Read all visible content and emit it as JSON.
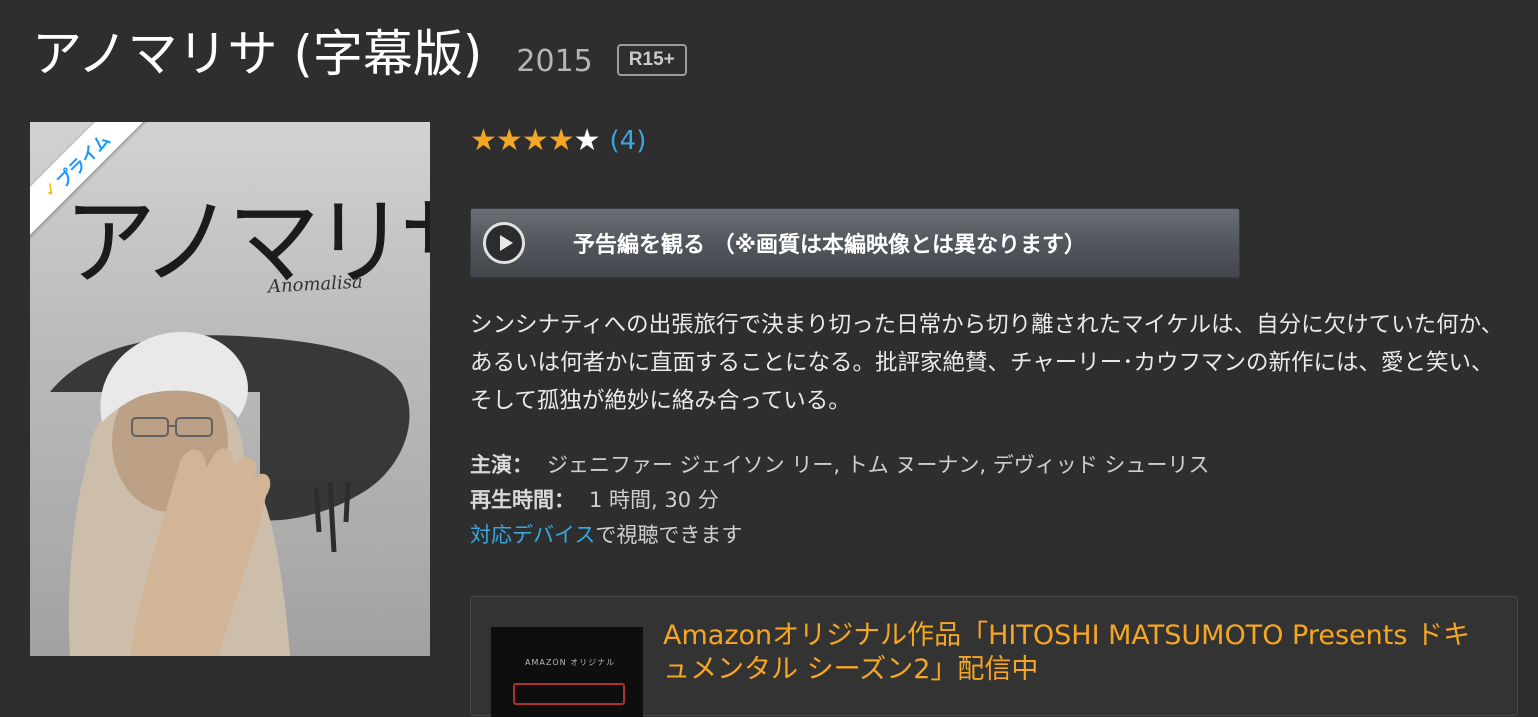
{
  "header": {
    "title": "アノマリサ (字幕版)",
    "year": "2015",
    "rating": "R15+"
  },
  "poster": {
    "badge": "プライム",
    "title_art": "アノマリサ",
    "subtitle_art": "Anomalisa"
  },
  "reviews": {
    "stars": 4.5,
    "count": "(4)"
  },
  "trailer": {
    "label": "予告編を観る （※画質は本編映像とは異なります）"
  },
  "synopsis": "シンシナティへの出張旅行で決まり切った日常から切り離されたマイケルは、自分に欠けていた何か、あるいは何者かに直面することになる。批評家絶賛、チャーリー･カウフマンの新作には、愛と笑い、そして孤独が絶妙に絡み合っている。",
  "details": {
    "cast_label": "主演：",
    "cast_value": "ジェニファー ジェイソン リー, トム ヌーナン, デヴィッド シューリス",
    "runtime_label": "再生時間：",
    "runtime_value": "1 時間, 30 分",
    "devices_link": "対応デバイス",
    "devices_suffix": "で視聴できます"
  },
  "promo": {
    "thumb_text": "AMAZON オリジナル",
    "text": "Amazonオリジナル作品「HITOSHI MATSUMOTO Presents ドキュメンタル シーズン2」配信中"
  },
  "colors": {
    "background": "#2e2e2e",
    "star": "#f5a623",
    "link": "#39a8e0",
    "promo_text": "#f5a623"
  }
}
